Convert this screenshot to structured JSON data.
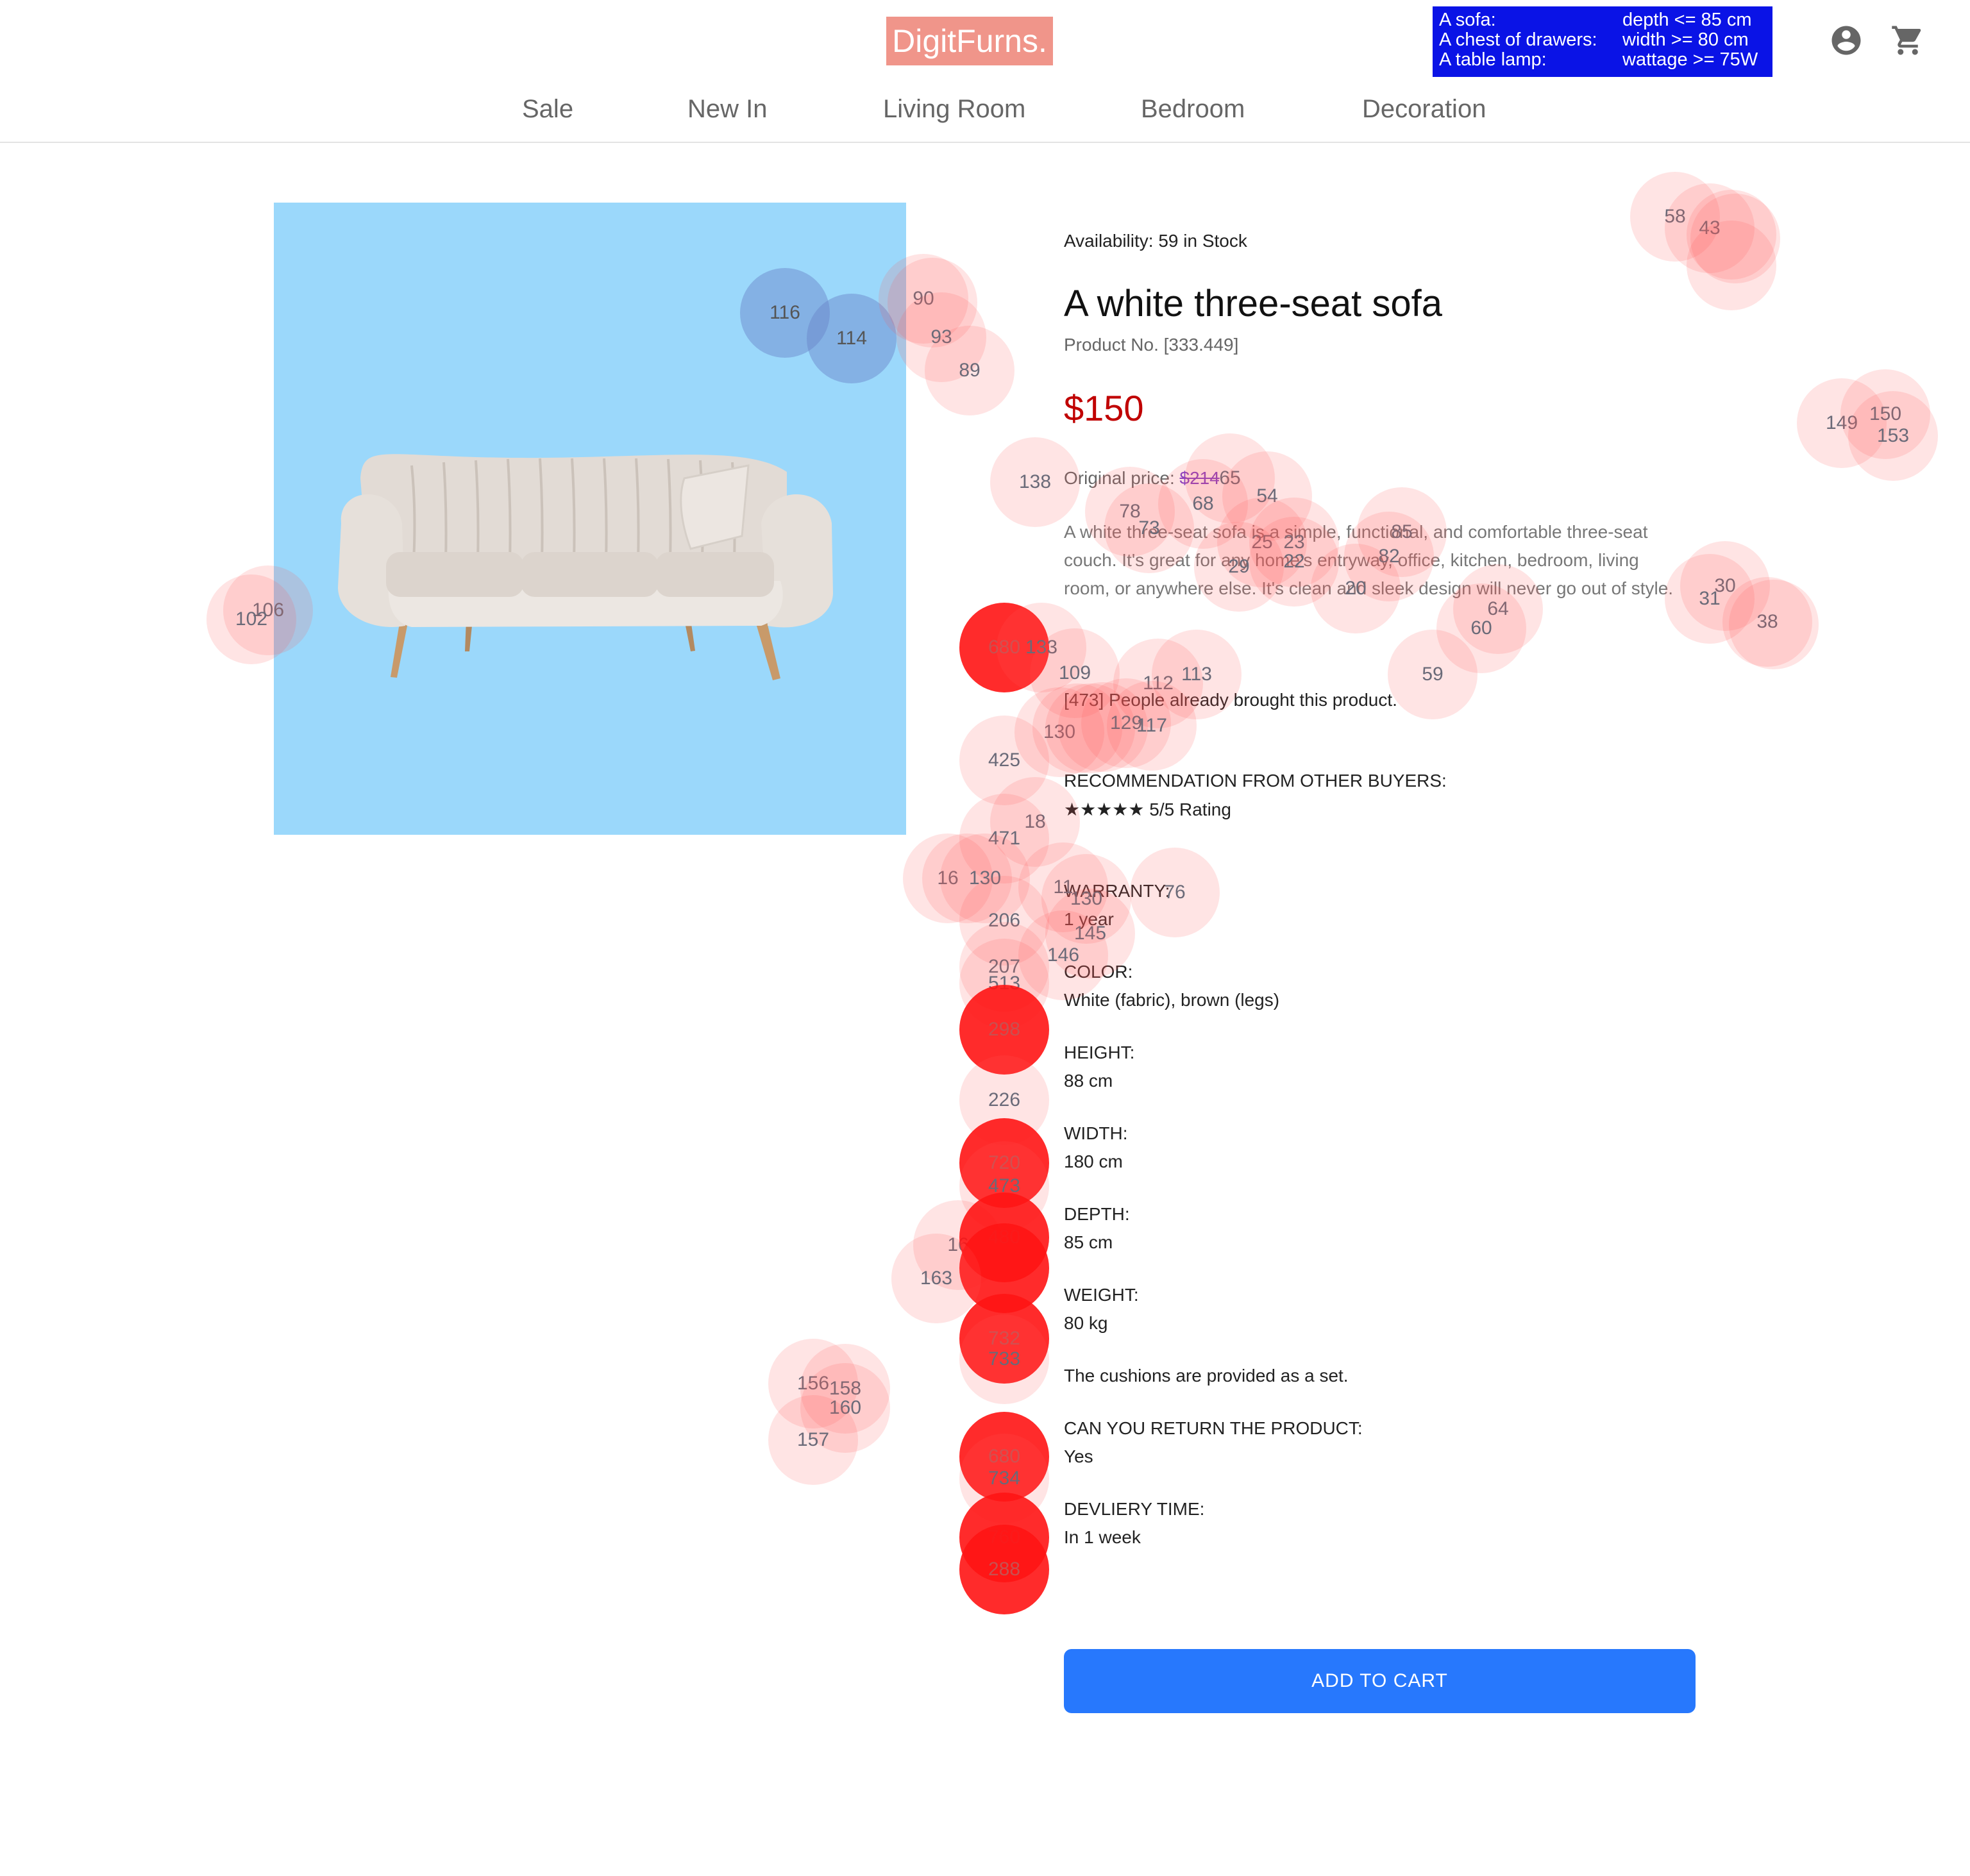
{
  "header": {
    "logo": "DigitFurns.",
    "task": [
      {
        "item": "A sofa:",
        "requirement": "depth <= 85 cm"
      },
      {
        "item": "A chest of drawers:",
        "requirement": "width >= 80 cm"
      },
      {
        "item": "A table lamp:",
        "requirement": "wattage >= 75W"
      }
    ],
    "icons": {
      "account": "account-circle-icon",
      "cart": "shopping-cart-icon"
    }
  },
  "nav": [
    "Sale",
    "New In",
    "Living Room",
    "Bedroom",
    "Decoration"
  ],
  "product": {
    "availability": "Availability: 59 in Stock",
    "title": "A white three-seat sofa",
    "product_no": "Product No. [333.449]",
    "price": "$150",
    "original_price_label": "Original price: ",
    "original_price": "$214",
    "description": "A white three-seat sofa is a simple, functional, and comfortable three-seat couch. It's great for any home's entryway, office, kitchen, bedroom, living room, or anywhere else. It's clean and sleek design will never go out of style.",
    "bought": "[473] People already brought this product.",
    "recommendation_title": "RECOMMENDATION FROM OTHER BUYERS:",
    "stars": "★★★★★",
    "rating": "5/5 Rating",
    "specs": [
      {
        "label": "WARRANTY:",
        "value": "1 year"
      },
      {
        "label": "COLOR:",
        "value": "White (fabric), brown (legs)"
      },
      {
        "label": "HEIGHT:",
        "value": "88 cm"
      },
      {
        "label": "WIDTH:",
        "value": "180 cm"
      },
      {
        "label": "DEPTH:",
        "value": "85 cm"
      },
      {
        "label": "WEIGHT:",
        "value": "80 kg"
      }
    ],
    "cushion_note": "The cushions are provided as a set.",
    "return_label": "CAN YOU RETURN THE PRODUCT:",
    "return_value": "Yes",
    "delivery_label": "DEVLIERY TIME:",
    "delivery_value": "In 1 week",
    "add_to_cart": "ADD TO CART"
  },
  "colors": {
    "logo_bg": "#f0958a",
    "task_bg": "#0a13e6",
    "price": "#c00000",
    "image_bg": "#9bd8fb",
    "button": "#2778fd"
  },
  "gaze_labels": {
    "g1": "58",
    "g2": "43",
    "g3": "116",
    "g4": "114",
    "g5": "90",
    "g6": "93",
    "g7": "89",
    "g8": "149",
    "g9": "150",
    "g10": "153",
    "g11": "138",
    "g12": "65",
    "g13": "54",
    "g14": "78",
    "g15": "68",
    "g16": "73",
    "g17": "25",
    "g18": "23",
    "g19": "85",
    "g20": "82",
    "g21": "22",
    "g22": "29",
    "g23": "20",
    "g24": "30",
    "g25": "31",
    "g26": "38",
    "g27": "64",
    "g28": "60",
    "g29": "106",
    "g30": "102",
    "g31": "680",
    "g32": "133",
    "g33": "109",
    "g34": "112",
    "g35": "113",
    "g36": "59",
    "g37": "130",
    "g38": "129",
    "g39": "117",
    "g40": "425",
    "g41": "18",
    "g42": "471",
    "g43": "16",
    "g44": "130",
    "g45": "11",
    "g46": "130",
    "g47": "76",
    "g48": "206",
    "g49": "145",
    "g50": "146",
    "g51": "207",
    "g52": "513",
    "g53": "298",
    "g54": "226",
    "g55": "720",
    "g56": "473",
    "g57": "16",
    "g58": "480",
    "g59": "163",
    "g60": "732",
    "g61": "733",
    "g62": "156",
    "g63": "158",
    "g64": "160",
    "g65": "157",
    "g66": "680",
    "g67": "734",
    "g68": "760",
    "g69": "288"
  }
}
